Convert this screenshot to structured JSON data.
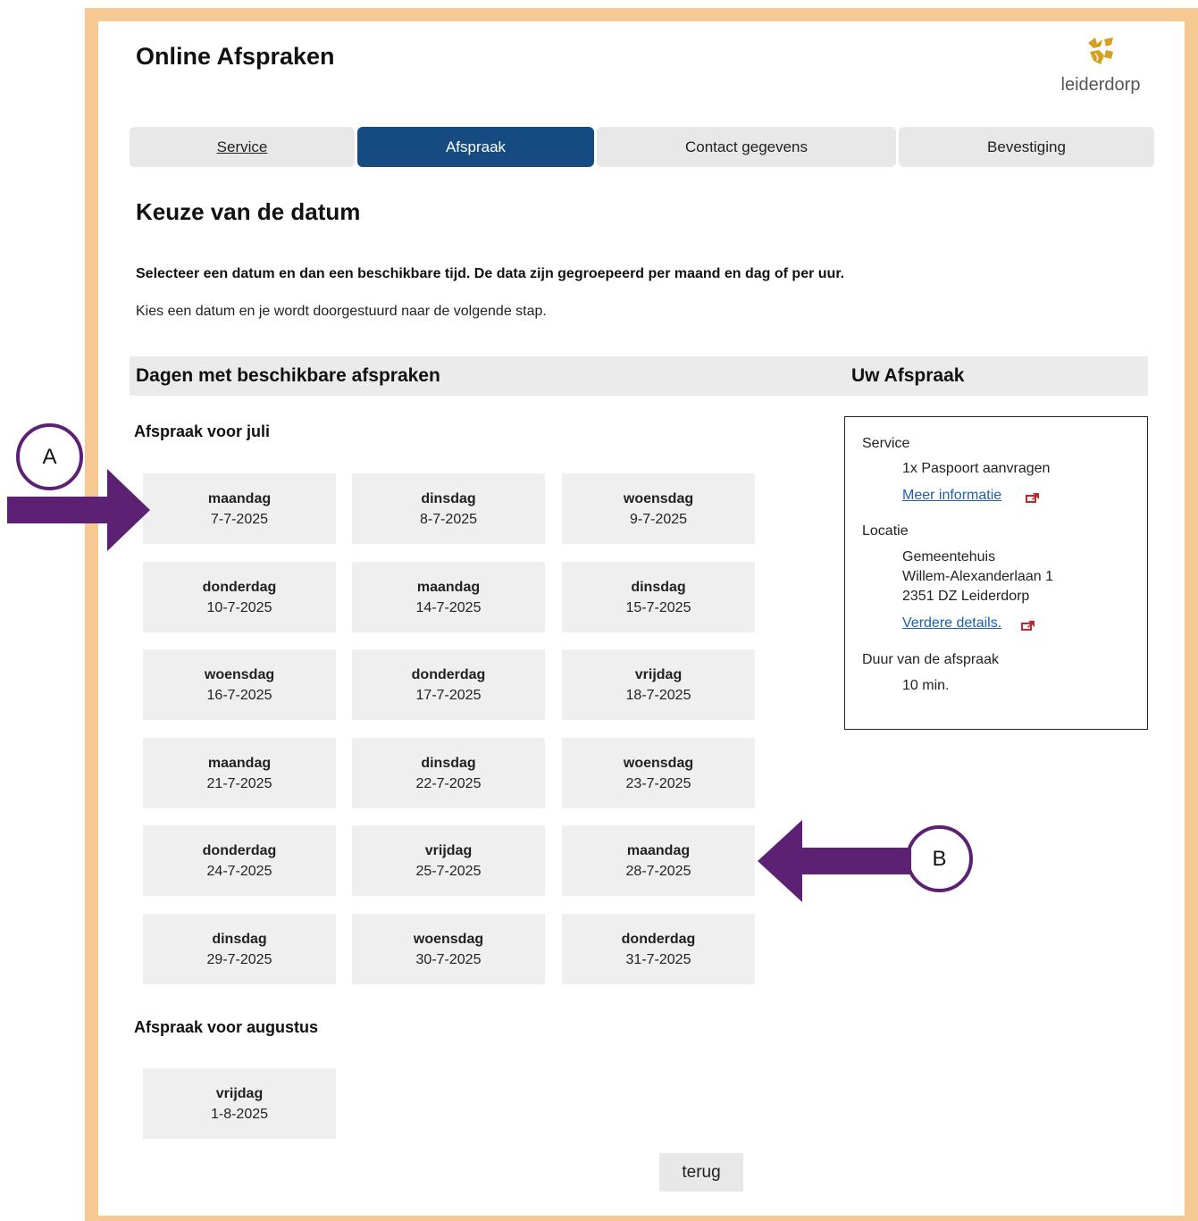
{
  "header": {
    "title": "Online Afspraken",
    "logo_text": "leiderdorp"
  },
  "tabs": [
    {
      "label": "Service"
    },
    {
      "label": "Afspraak"
    },
    {
      "label": "Contact gegevens"
    },
    {
      "label": "Bevestiging"
    }
  ],
  "page": {
    "heading": "Keuze van de datum",
    "instruction_bold": "Selecteer een datum en dan een beschikbare tijd. De data zijn gegroepeerd per maand en dag of per uur.",
    "instruction": "Kies een datum en je wordt doorgestuurd naar de volgende stap."
  },
  "section_bar": {
    "left": "Dagen met beschikbare afspraken",
    "right": "Uw Afspraak"
  },
  "months": [
    {
      "label": "Afspraak voor juli",
      "dates": [
        {
          "day": "maandag",
          "date": "7-7-2025"
        },
        {
          "day": "dinsdag",
          "date": "8-7-2025"
        },
        {
          "day": "woensdag",
          "date": "9-7-2025"
        },
        {
          "day": "donderdag",
          "date": "10-7-2025"
        },
        {
          "day": "maandag",
          "date": "14-7-2025"
        },
        {
          "day": "dinsdag",
          "date": "15-7-2025"
        },
        {
          "day": "woensdag",
          "date": "16-7-2025"
        },
        {
          "day": "donderdag",
          "date": "17-7-2025"
        },
        {
          "day": "vrijdag",
          "date": "18-7-2025"
        },
        {
          "day": "maandag",
          "date": "21-7-2025"
        },
        {
          "day": "dinsdag",
          "date": "22-7-2025"
        },
        {
          "day": "woensdag",
          "date": "23-7-2025"
        },
        {
          "day": "donderdag",
          "date": "24-7-2025"
        },
        {
          "day": "vrijdag",
          "date": "25-7-2025"
        },
        {
          "day": "maandag",
          "date": "28-7-2025"
        },
        {
          "day": "dinsdag",
          "date": "29-7-2025"
        },
        {
          "day": "woensdag",
          "date": "30-7-2025"
        },
        {
          "day": "donderdag",
          "date": "31-7-2025"
        }
      ]
    },
    {
      "label": "Afspraak voor augustus",
      "dates": [
        {
          "day": "vrijdag",
          "date": "1-8-2025"
        }
      ]
    }
  ],
  "summary": {
    "service_label": "Service",
    "service_value": "1x Paspoort aanvragen",
    "service_link": "Meer informatie",
    "location_label": "Locatie",
    "location_name": "Gemeentehuis",
    "location_street": "Willem-Alexanderlaan 1",
    "location_city": "2351 DZ Leiderdorp",
    "location_link": "Verdere details.",
    "duration_label": "Duur van de afspraak",
    "duration_value": "10 min."
  },
  "back_button": "terug",
  "annotations": {
    "marker_a": "A",
    "marker_b": "B"
  },
  "colors": {
    "frame": "#f6c993",
    "active_tab": "#164b82",
    "arrow": "#5c2173",
    "link": "#1f5fa8",
    "logo": "#d4a11e"
  }
}
